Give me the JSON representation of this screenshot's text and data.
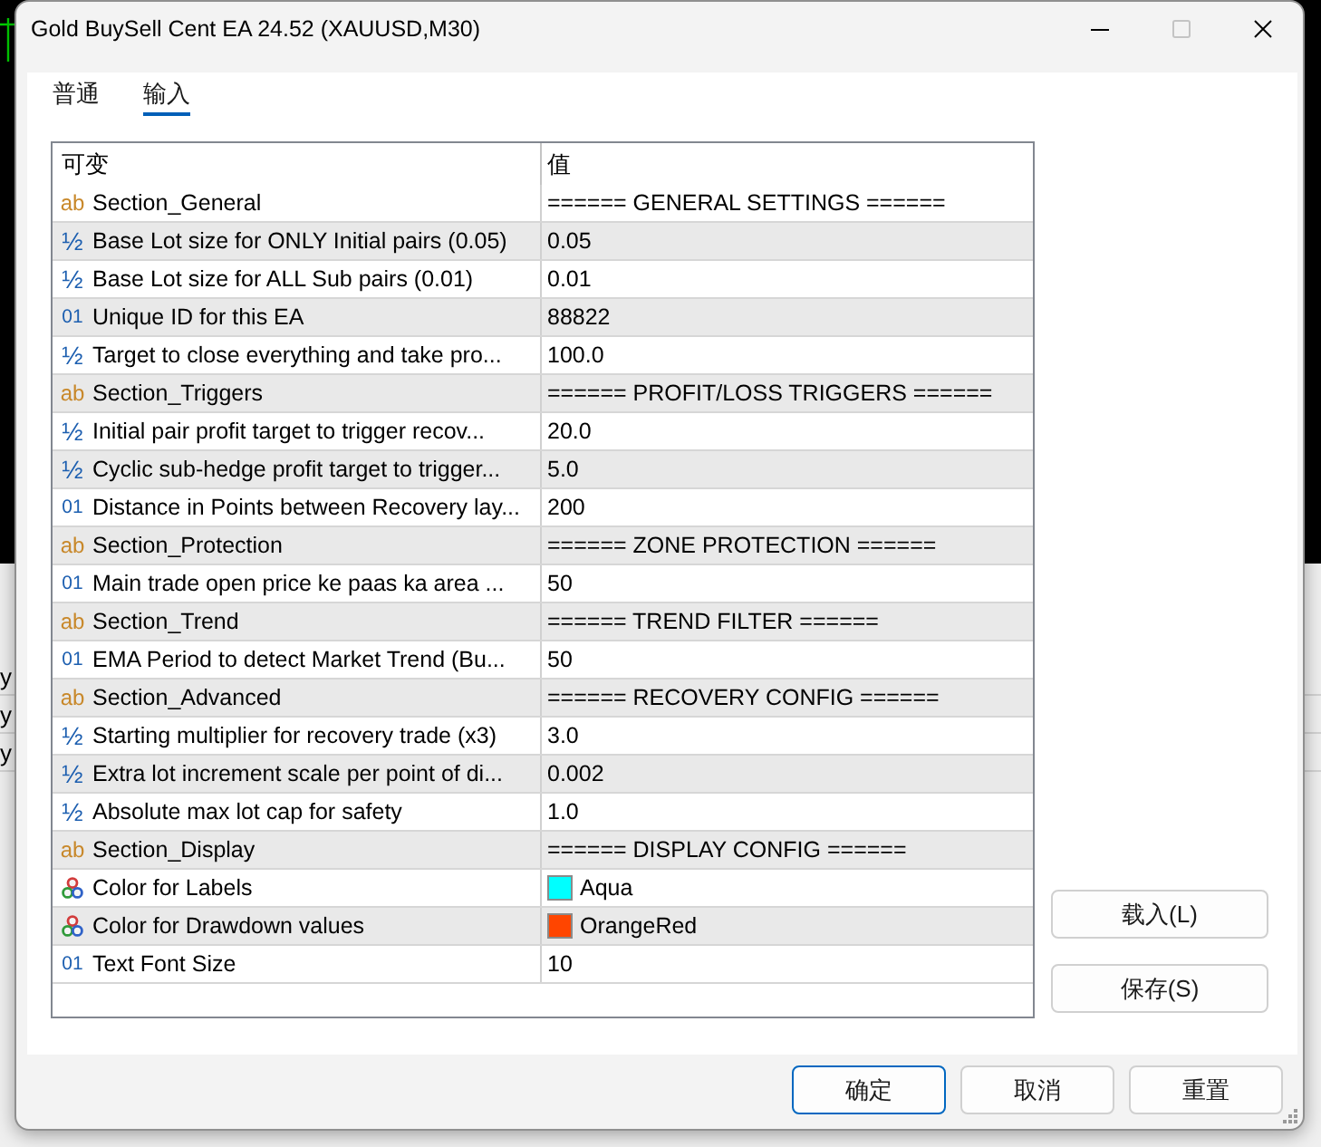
{
  "window": {
    "title": "Gold BuySell Cent EA 24.52 (XAUUSD,M30)"
  },
  "background": {
    "panel_items": [
      "y",
      "y",
      "y"
    ]
  },
  "tabs": [
    {
      "label": "普通",
      "selected": false
    },
    {
      "label": "输入",
      "selected": true
    }
  ],
  "table": {
    "columns": [
      "可变",
      "值"
    ],
    "rows": [
      {
        "kind": "string",
        "icon": "ab",
        "name": "Section_General",
        "value": "====== GENERAL SETTINGS ======"
      },
      {
        "kind": "double",
        "icon": "½",
        "name": "Base Lot size for ONLY Initial pairs (0.05)",
        "value": "0.05"
      },
      {
        "kind": "double",
        "icon": "½",
        "name": "Base Lot size for ALL Sub pairs (0.01)",
        "value": "0.01"
      },
      {
        "kind": "int",
        "icon": "01",
        "name": "Unique ID for this EA",
        "value": "88822"
      },
      {
        "kind": "double",
        "icon": "½",
        "name": "Target to close everything and take pro...",
        "value": "100.0"
      },
      {
        "kind": "string",
        "icon": "ab",
        "name": "Section_Triggers",
        "value": "====== PROFIT/LOSS TRIGGERS ======"
      },
      {
        "kind": "double",
        "icon": "½",
        "name": "Initial pair profit target to trigger recov...",
        "value": "20.0"
      },
      {
        "kind": "double",
        "icon": "½",
        "name": "Cyclic sub-hedge profit target to trigger...",
        "value": "5.0"
      },
      {
        "kind": "int",
        "icon": "01",
        "name": "Distance in Points between Recovery lay...",
        "value": "200"
      },
      {
        "kind": "string",
        "icon": "ab",
        "name": "Section_Protection",
        "value": "====== ZONE PROTECTION ======"
      },
      {
        "kind": "int",
        "icon": "01",
        "name": "Main trade open price ke paas ka area ...",
        "value": "50"
      },
      {
        "kind": "string",
        "icon": "ab",
        "name": "Section_Trend",
        "value": "====== TREND FILTER ======"
      },
      {
        "kind": "int",
        "icon": "01",
        "name": "EMA Period to detect Market Trend (Bu...",
        "value": "50"
      },
      {
        "kind": "string",
        "icon": "ab",
        "name": "Section_Advanced",
        "value": "====== RECOVERY CONFIG ======"
      },
      {
        "kind": "double",
        "icon": "½",
        "name": "Starting multiplier for recovery trade (x3)",
        "value": "3.0"
      },
      {
        "kind": "double",
        "icon": "½",
        "name": "Extra lot increment scale per point of di...",
        "value": "0.002"
      },
      {
        "kind": "double",
        "icon": "½",
        "name": "Absolute max lot cap for safety",
        "value": "1.0"
      },
      {
        "kind": "string",
        "icon": "ab",
        "name": "Section_Display",
        "value": "====== DISPLAY CONFIG ======"
      },
      {
        "kind": "color",
        "name": "Color for Labels",
        "value": "Aqua",
        "color": "#00ffff"
      },
      {
        "kind": "color",
        "name": "Color for Drawdown values",
        "value": "OrangeRed",
        "color": "#ff4500"
      },
      {
        "kind": "int",
        "icon": "01",
        "name": "Text Font Size",
        "value": "10"
      }
    ]
  },
  "side_buttons": [
    "载入(L)",
    "保存(S)"
  ],
  "buttons": [
    {
      "label": "确定",
      "default": true
    },
    {
      "label": "取消",
      "default": false
    },
    {
      "label": "重置",
      "default": false
    }
  ]
}
